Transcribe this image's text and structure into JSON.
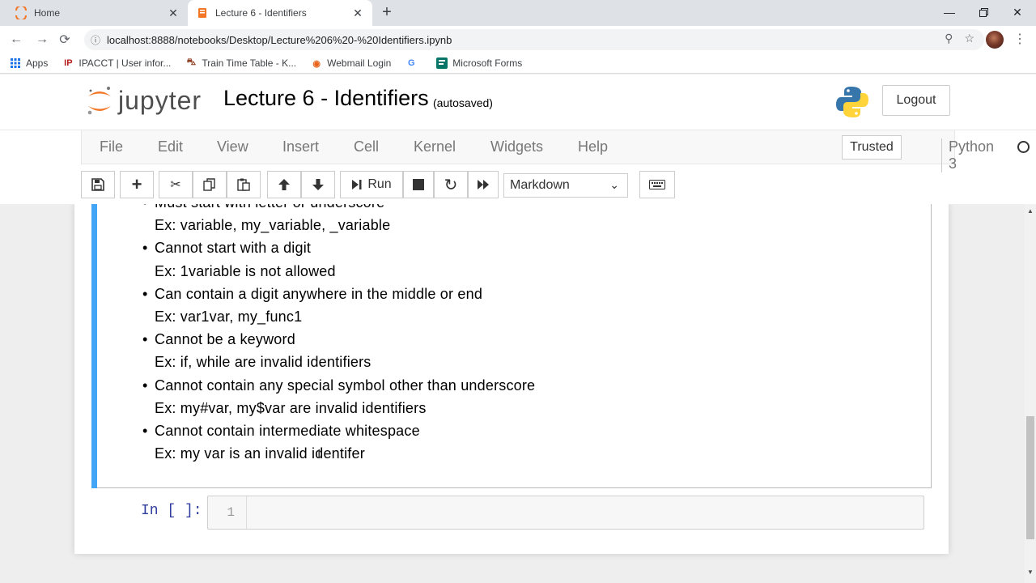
{
  "browser": {
    "tabs": [
      {
        "title": "Home",
        "favicon": "jupyter-icon"
      },
      {
        "title": "Lecture 6 - Identifiers",
        "favicon": "jupyter-icon"
      }
    ],
    "url": "localhost:8888/notebooks/Desktop/Lecture%206%20-%20Identifiers.ipynb",
    "bookmarks": [
      {
        "label": "Apps",
        "icon": "apps-grid-icon"
      },
      {
        "label": "IPACCT | User infor...",
        "icon": "ipacct-icon"
      },
      {
        "label": "Train Time Table - K...",
        "icon": "train-icon"
      },
      {
        "label": "Webmail Login",
        "icon": "webmail-icon"
      },
      {
        "label": "",
        "icon": "google-icon"
      },
      {
        "label": "Microsoft Forms",
        "icon": "forms-icon"
      }
    ]
  },
  "jupyter": {
    "logo_text": "jupyter",
    "notebook_title": "Lecture 6 - Identifiers",
    "autosave_status": "(autosaved)",
    "logout_label": "Logout",
    "menu": [
      "File",
      "Edit",
      "View",
      "Insert",
      "Cell",
      "Kernel",
      "Widgets",
      "Help"
    ],
    "trusted_label": "Trusted",
    "kernel_name": "Python 3",
    "run_label": "Run",
    "cell_type": "Markdown"
  },
  "markdown_cell": {
    "partial_first_line": "Must start with letter or underscore",
    "first_example": "Ex: variable, my_variable, _variable",
    "rules": [
      {
        "rule": "Cannot start with a digit",
        "example": "Ex: 1variable is not allowed"
      },
      {
        "rule": "Can contain a digit anywhere in the middle or end",
        "example": "Ex: var1var, my_func1"
      },
      {
        "rule": "Cannot be a keyword",
        "example": "Ex: if, while are invalid identifiers"
      },
      {
        "rule": "Cannot contain any special symbol other than underscore",
        "example": "Ex: my#var, my$var are invalid identifiers"
      },
      {
        "rule": "Cannot contain intermediate whitespace",
        "example": "Ex: my var is an invalid identifer"
      }
    ]
  },
  "code_cell": {
    "prompt": "In [ ]:",
    "line_number": "1"
  },
  "colors": {
    "selected_cell_bar": "#42a5f5",
    "prompt_blue": "#303f9f"
  }
}
